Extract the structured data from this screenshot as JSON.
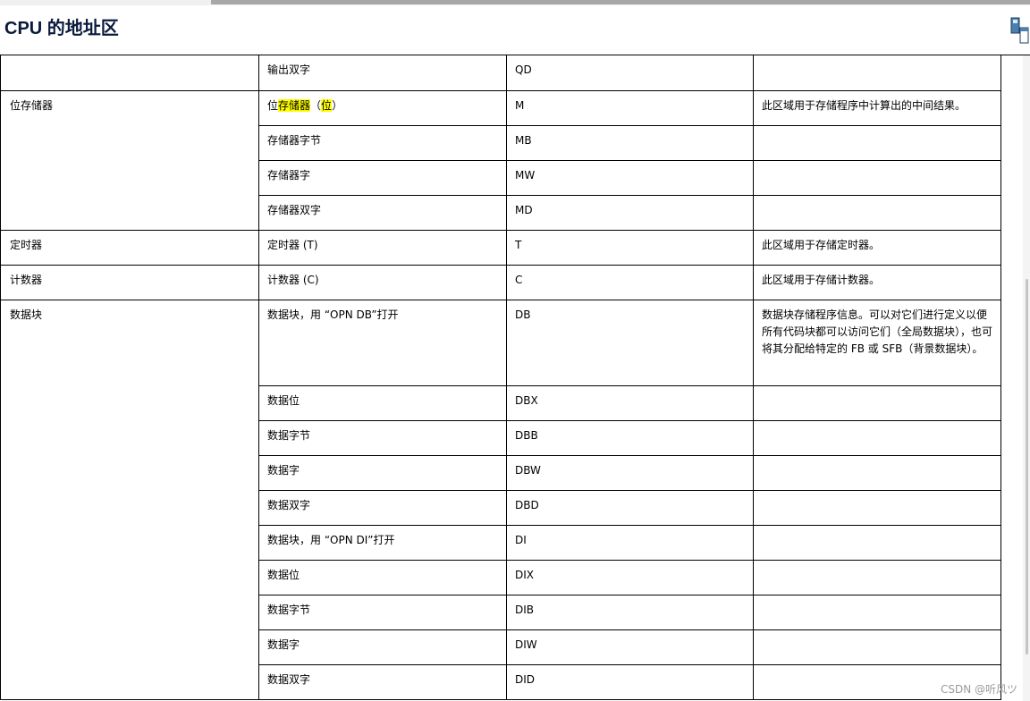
{
  "page": {
    "title": "CPU 的地址区"
  },
  "table": {
    "rows": [
      {
        "area": "",
        "unit_parts": [
          {
            "text": "输出双字",
            "hl": false
          }
        ],
        "abbrev": "QD",
        "desc": ""
      },
      {
        "area": "位存储器",
        "unit_parts": [
          {
            "text": "位",
            "hl": false
          },
          {
            "text": "存储器",
            "hl": true
          },
          {
            "text": "（",
            "hl": false
          },
          {
            "text": "位",
            "hl": true
          },
          {
            "text": "）",
            "hl": false
          }
        ],
        "abbrev": "M",
        "desc": "此区域用于存储程序中计算出的中间结果。"
      },
      {
        "area": "",
        "unit_parts": [
          {
            "text": "存储器字节",
            "hl": false
          }
        ],
        "abbrev": "MB",
        "desc": ""
      },
      {
        "area": "",
        "unit_parts": [
          {
            "text": "存储器字",
            "hl": false
          }
        ],
        "abbrev": "MW",
        "desc": ""
      },
      {
        "area": "",
        "unit_parts": [
          {
            "text": "存储器双字",
            "hl": false
          }
        ],
        "abbrev": "MD",
        "desc": ""
      },
      {
        "area": "定时器",
        "unit_parts": [
          {
            "text": "定时器 (T)",
            "hl": false
          }
        ],
        "abbrev": "T",
        "desc": "此区域用于存储定时器。"
      },
      {
        "area": "计数器",
        "unit_parts": [
          {
            "text": "计数器 (C)",
            "hl": false
          }
        ],
        "abbrev": "C",
        "desc": "此区域用于存储计数器。"
      },
      {
        "area": "数据块",
        "unit_parts": [
          {
            "text": "数据块，用 “OPN DB”打开",
            "hl": false
          }
        ],
        "abbrev": "DB",
        "desc": "数据块存储程序信息。可以对它们进行定义以便所有代码块都可以访问它们（全局数据块），也可将其分配给特定的 FB 或 SFB（背景数据块）。"
      },
      {
        "area": "",
        "unit_parts": [
          {
            "text": "数据位",
            "hl": false
          }
        ],
        "abbrev": "DBX",
        "desc": ""
      },
      {
        "area": "",
        "unit_parts": [
          {
            "text": "数据字节",
            "hl": false
          }
        ],
        "abbrev": "DBB",
        "desc": ""
      },
      {
        "area": "",
        "unit_parts": [
          {
            "text": "数据字",
            "hl": false
          }
        ],
        "abbrev": "DBW",
        "desc": ""
      },
      {
        "area": "",
        "unit_parts": [
          {
            "text": "数据双字",
            "hl": false
          }
        ],
        "abbrev": "DBD",
        "desc": ""
      },
      {
        "area": "",
        "unit_parts": [
          {
            "text": "数据块，用 “OPN DI”打开",
            "hl": false
          }
        ],
        "abbrev": "DI",
        "desc": ""
      },
      {
        "area": "",
        "unit_parts": [
          {
            "text": "数据位",
            "hl": false
          }
        ],
        "abbrev": "DIX",
        "desc": ""
      },
      {
        "area": "",
        "unit_parts": [
          {
            "text": "数据字节",
            "hl": false
          }
        ],
        "abbrev": "DIB",
        "desc": ""
      },
      {
        "area": "",
        "unit_parts": [
          {
            "text": "数据字",
            "hl": false
          }
        ],
        "abbrev": "DIW",
        "desc": ""
      },
      {
        "area": "",
        "unit_parts": [
          {
            "text": "数据双字",
            "hl": false
          }
        ],
        "abbrev": "DID",
        "desc": ""
      }
    ]
  },
  "watermark": "CSDN @听风ツ",
  "colors": {
    "title": "#0a1a3c",
    "highlight": "#ffff00",
    "border": "#000000"
  }
}
